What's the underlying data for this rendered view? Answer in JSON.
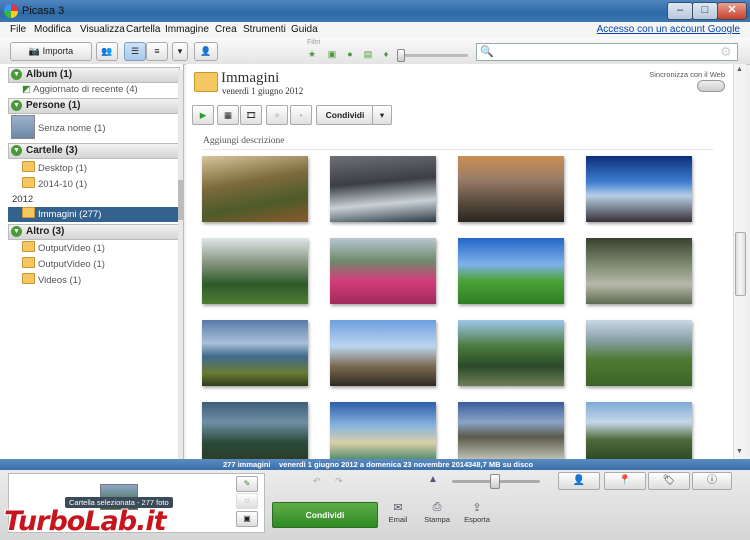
{
  "window": {
    "title": "Picasa 3",
    "minimize": "–",
    "maximize": "□",
    "close": "✕"
  },
  "menu": {
    "items": [
      "File",
      "Modifica",
      "Visualizza",
      "Cartella",
      "Immagine",
      "Crea",
      "Strumenti",
      "Guida"
    ],
    "account_link": "Accesso con un account Google"
  },
  "toolbar": {
    "import_label": "Importa",
    "filters_label": "Filtri"
  },
  "search": {
    "placeholder": ""
  },
  "sidebar": {
    "albums": {
      "header": "Album (1)",
      "items": [
        "Aggiornato di recente (4)"
      ]
    },
    "people": {
      "header": "Persone (1)",
      "items": [
        "Senza nome (1)"
      ]
    },
    "folders": {
      "header": "Cartelle (3)",
      "items": [
        "Desktop (1)",
        "2014-10 (1)"
      ]
    },
    "year": "2012",
    "selected": "Immagini (277)",
    "other": {
      "header": "Altro (3)",
      "items": [
        "OutputVideo (1)",
        "OutputVideo (1)",
        "Videos (1)"
      ]
    }
  },
  "main": {
    "title": "Immagini",
    "date": "venerdì 1 giugno 2012",
    "sync_label": "Sincronizza con il Web",
    "share_label": "Condividi",
    "add_description": "Aggiungi descrizione"
  },
  "status": {
    "count": "277 immagini",
    "range": "venerdì 1 giugno 2012 a domenica 23 novembre 2014",
    "size": "348,7 MB su disco"
  },
  "tray": {
    "tooltip": "Cartella selezionata - 277 foto",
    "share_button": "Condividi",
    "email": "Email",
    "print": "Stampa",
    "export": "Esporta"
  },
  "watermark": "TurboLab.it"
}
